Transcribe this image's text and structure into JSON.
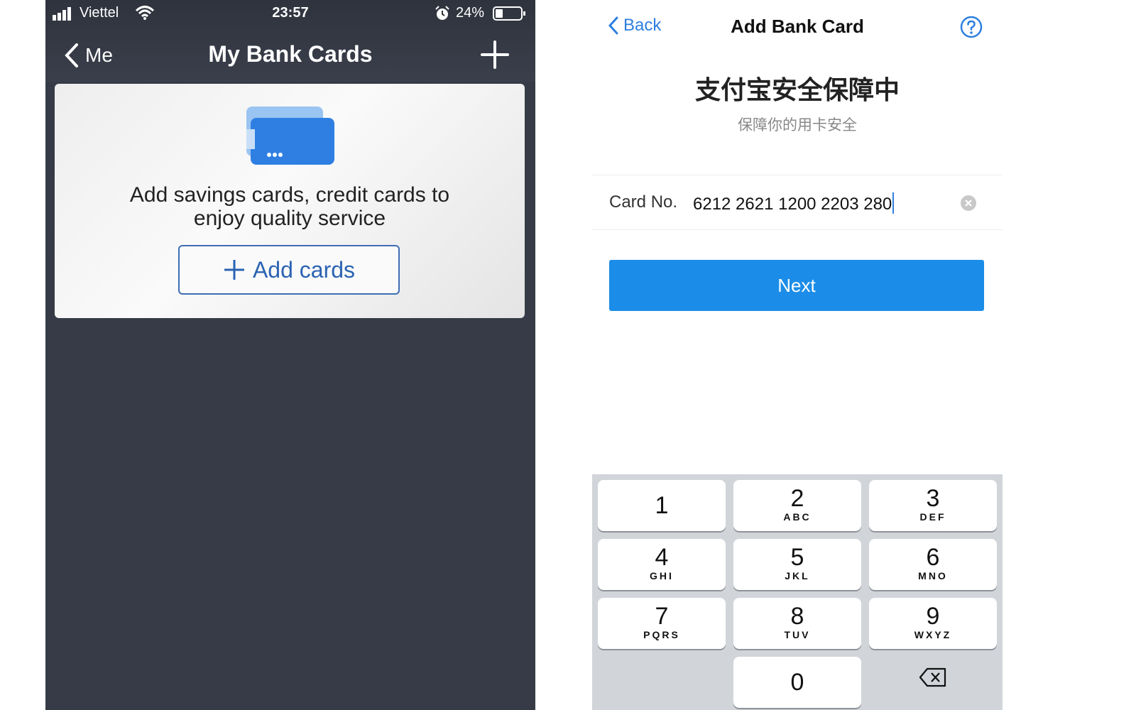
{
  "left": {
    "status": {
      "carrier": "Viettel",
      "time": "23:57",
      "battery": "24%"
    },
    "nav": {
      "back_label": "Me",
      "title": "My Bank Cards"
    },
    "empty_state": {
      "message_line1": "Add savings cards, credit cards to",
      "message_line2": "enjoy quality service",
      "add_button_label": "Add cards"
    }
  },
  "right": {
    "nav": {
      "back_label": "Back",
      "title": "Add Bank Card"
    },
    "security": {
      "title": "支付宝安全保障中",
      "subtitle": "保障你的用卡安全"
    },
    "card_field": {
      "label": "Card No.",
      "value": "6212 2621 1200 2203 280"
    },
    "next_label": "Next",
    "keypad": [
      {
        "digit": "1",
        "letters": ""
      },
      {
        "digit": "2",
        "letters": "ABC"
      },
      {
        "digit": "3",
        "letters": "DEF"
      },
      {
        "digit": "4",
        "letters": "GHI"
      },
      {
        "digit": "5",
        "letters": "JKL"
      },
      {
        "digit": "6",
        "letters": "MNO"
      },
      {
        "digit": "7",
        "letters": "PQRS"
      },
      {
        "digit": "8",
        "letters": "TUV"
      },
      {
        "digit": "9",
        "letters": "WXYZ"
      },
      {
        "digit": "0",
        "letters": ""
      }
    ]
  },
  "colors": {
    "dark_background": "#363b47",
    "accent_blue": "#1b8de8",
    "link_blue": "#2d7fe0",
    "button_outline": "#3f6db3",
    "keypad_background": "#d1d4d9"
  },
  "icons": [
    "signal-icon",
    "wifi-icon",
    "alarm-icon",
    "battery-icon",
    "chevron-left-icon",
    "plus-icon",
    "cards-icon",
    "help-icon",
    "clear-icon",
    "delete-icon"
  ]
}
